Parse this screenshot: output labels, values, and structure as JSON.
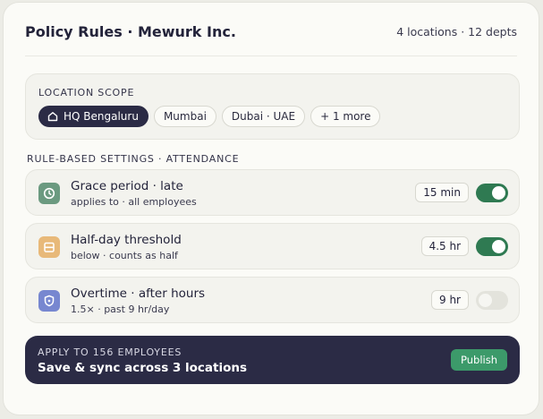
{
  "header": {
    "title": "Policy Rules · Mewurk Inc.",
    "meta": "4 locations · 12 depts"
  },
  "scope": {
    "label": "LOCATION SCOPE",
    "chips": [
      "HQ Bengaluru",
      "Mumbai",
      "Dubai · UAE",
      "+ 1 more"
    ],
    "active_chip": "HQ Bengaluru"
  },
  "rules": {
    "label": "RULE-BASED SETTINGS · ATTENDANCE",
    "items": [
      {
        "name": "Grace period · late",
        "sub": "applies to · all employees",
        "value": "15 min",
        "enabled": true,
        "icon": "clock-icon",
        "color": "#6b9a80"
      },
      {
        "name": "Half-day threshold",
        "sub": "below · counts as half",
        "value": "4.5 hr",
        "enabled": true,
        "icon": "calendar-icon",
        "color": "#e8b979"
      },
      {
        "name": "Overtime · after hours",
        "sub": "1.5× · past 9 hr/day",
        "value": "9 hr",
        "enabled": false,
        "icon": "shield-icon",
        "color": "#7787d0"
      }
    ]
  },
  "cta": {
    "small": "APPLY TO 156 EMPLOYEES",
    "big": "Save & sync across 3 locations",
    "button": "Publish"
  }
}
